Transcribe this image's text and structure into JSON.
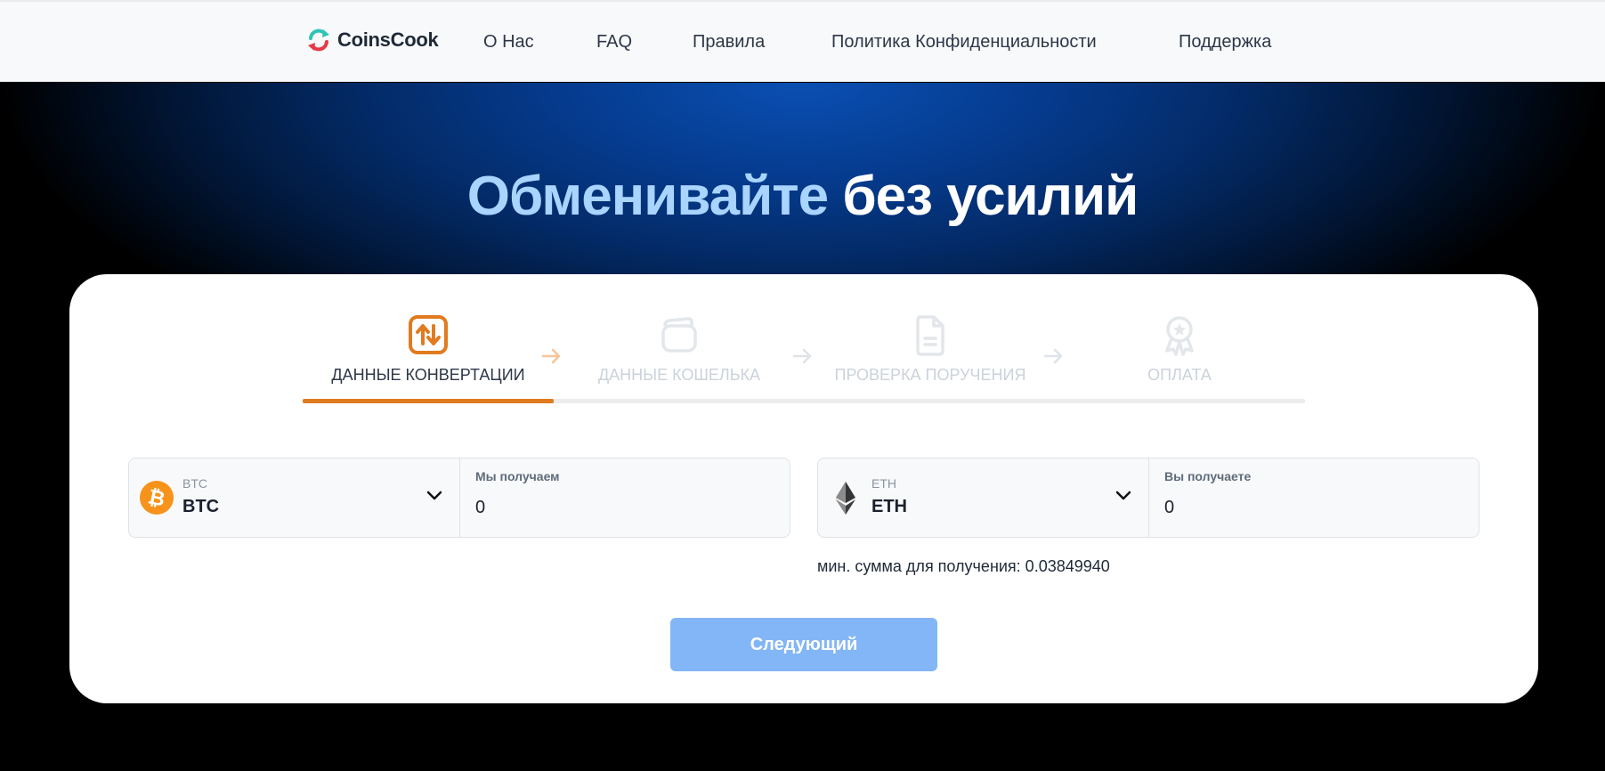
{
  "header": {
    "brand": "CoinsCook",
    "nav": [
      "О Нас",
      "FAQ",
      "Правила",
      "Политика Конфиденциальности",
      "Поддержка"
    ]
  },
  "hero": {
    "title_accent": "Обменивайте",
    "title_rest": "без усилий"
  },
  "stepper": {
    "steps": [
      {
        "label": "ДАННЫЕ КОНВЕРТАЦИИ",
        "icon": "swap-arrows-icon",
        "state": "active"
      },
      {
        "label": "ДАННЫЕ КОШЕЛЬКА",
        "icon": "wallet-icon",
        "state": "inactive"
      },
      {
        "label": "ПРОВЕРКА ПОРУЧЕНИЯ",
        "icon": "document-icon",
        "state": "inactive"
      },
      {
        "label": "ОПЛАТА",
        "icon": "award-badge-icon",
        "state": "inactive"
      }
    ],
    "progress_fraction": 0.25
  },
  "send": {
    "ticker_small": "BTC",
    "ticker": "BTC",
    "amount_label": "Мы получаем",
    "amount_value": "0"
  },
  "receive": {
    "ticker_small": "ETH",
    "ticker": "ETH",
    "amount_label": "Вы получаете",
    "amount_value": "0",
    "min_note": "мин. сумма для получения: 0.03849940"
  },
  "actions": {
    "next_label": "Следующий"
  },
  "colors": {
    "accent_orange": "#e07b20",
    "button_blue": "#83b6f6",
    "hero_accent": "#a8d4ff",
    "btc_orange": "#f7931a"
  }
}
